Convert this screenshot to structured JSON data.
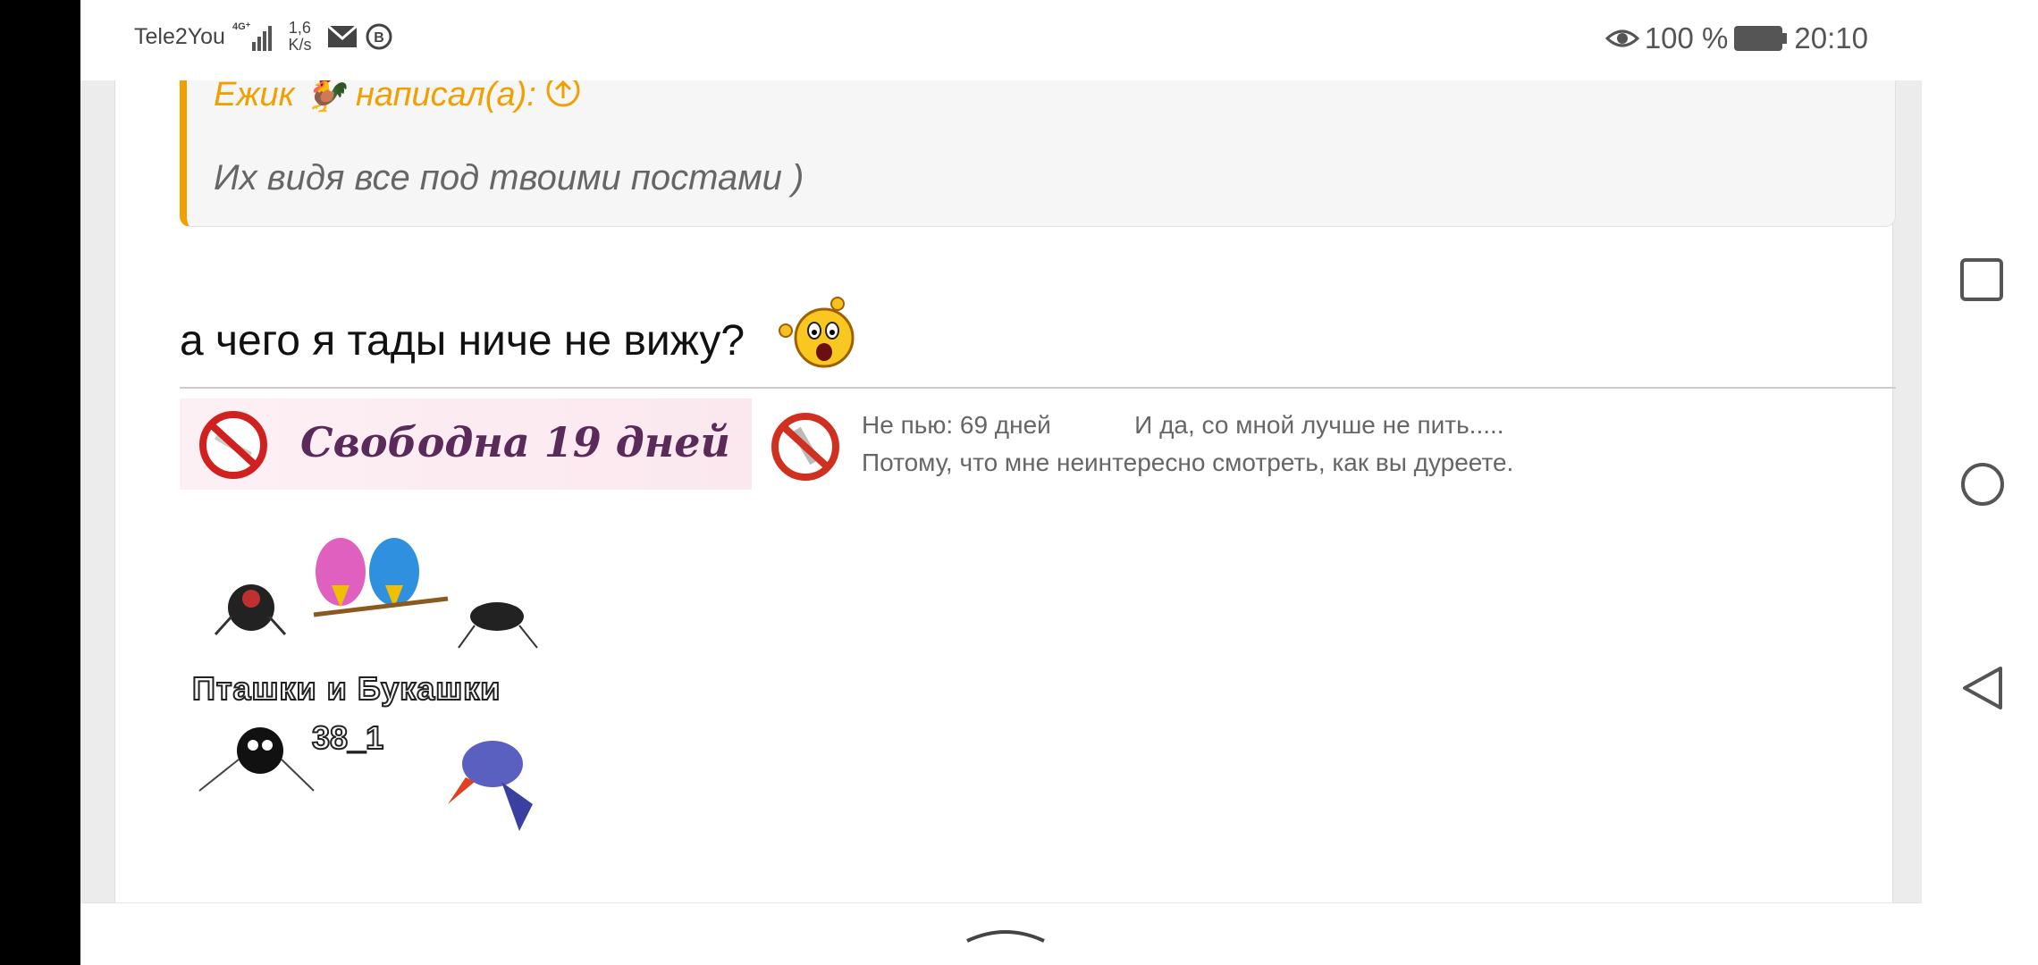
{
  "status_bar": {
    "carrier": "Tele2You",
    "network_type": "4G⁺",
    "speed_value": "1,6",
    "speed_unit": "K/s",
    "battery": "100 %",
    "time": "20:10"
  },
  "quote": {
    "author": "Ежик 🐓 написал(а):",
    "text": "Их видя все под твоими постами )"
  },
  "reply": {
    "text": "а чего я тады ниче не вижу?"
  },
  "signatures": {
    "banner1": "Свободна 19 дней",
    "banner2_line1": "Не пью: 69 дней            И да, со мной лучше не пить.....",
    "banner2_line2": "Потому, что мне неинтересно смотреть, как вы дуреете.",
    "banner3_title": "Пташки и Букашки",
    "banner3_num": "38_1"
  },
  "colors": {
    "accent": "#f0a000",
    "nav_icon": "#555555"
  }
}
